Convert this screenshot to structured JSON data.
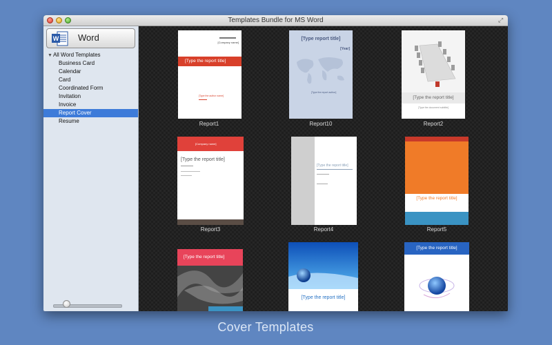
{
  "window": {
    "title": "Templates Bundle for MS Word"
  },
  "sidebar": {
    "app_button_label": "Word",
    "app_icon_letter": "W",
    "root_label": "All Word Templates",
    "items": [
      {
        "label": "Business Card"
      },
      {
        "label": "Calendar"
      },
      {
        "label": "Card"
      },
      {
        "label": "Coordinated Form"
      },
      {
        "label": "Invitation"
      },
      {
        "label": "Invoice"
      },
      {
        "label": "Report Cover",
        "selected": true
      },
      {
        "label": "Resume"
      }
    ]
  },
  "templates": [
    {
      "label": "Report1",
      "title_text": "[Type the report title]",
      "company": "[Company name]",
      "author": "[Type the author name]"
    },
    {
      "label": "Report10",
      "title_text": "[Type report title]",
      "year": "[Year]",
      "author": "[Type the report author]"
    },
    {
      "label": "Report2",
      "title_text": "[Type the report title]",
      "subtitle": "[Type the document subtitle]"
    },
    {
      "label": "Report3",
      "title_text": "[Type the report title]",
      "company": "[Company name]"
    },
    {
      "label": "Report4",
      "title_text": "[Type the report title]"
    },
    {
      "label": "Report5",
      "title_text": "[Type the report title]"
    },
    {
      "title_text": "[Type the report title]"
    },
    {
      "title_text": "[Type the report title]"
    },
    {
      "title_text": "[Type the report title]"
    }
  ],
  "caption": "Cover Templates",
  "colors": {
    "background": "#5f86c1",
    "selection": "#3d7bd9",
    "report1_band": "#d8402a",
    "report3_top": "#e0413a",
    "report5_orange": "#f07b28",
    "report5_blue": "#3a93c3"
  }
}
